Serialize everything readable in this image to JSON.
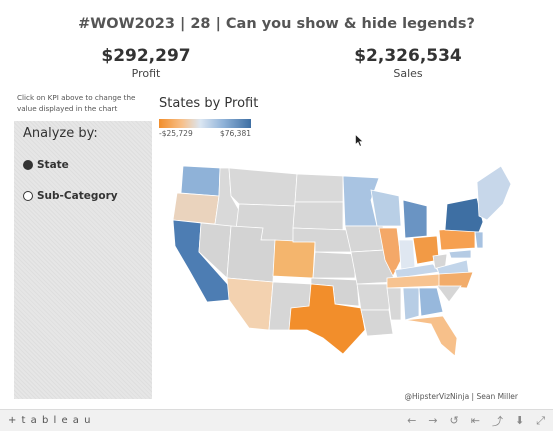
{
  "dashboard": {
    "title": "#WOW2023 | 28 | Can you show & hide legends?",
    "kpis": [
      {
        "value": "$292,297",
        "label": "Profit"
      },
      {
        "value": "$2,326,534",
        "label": "Sales"
      }
    ],
    "hint": "Click on KPI above to change the value displayed in the chart",
    "credit": "@HipsterVizNinja | Sean Miller"
  },
  "panel": {
    "heading": "Analyze by:",
    "options": [
      {
        "label": "State",
        "selected": true
      },
      {
        "label": "Sub-Category",
        "selected": false
      }
    ]
  },
  "map": {
    "title": "States by Profit",
    "legend_min": "-$25,729",
    "legend_max": "$76,381",
    "colors": {
      "negative": "#f28e2b",
      "neutral": "#d4d4d4",
      "positive": "#3e6fa3"
    }
  },
  "toolbar": {
    "logo": "+ t a b l e a u",
    "icons": [
      "undo-icon",
      "redo-icon",
      "revert-icon",
      "pause-icon",
      "share-icon",
      "download-icon",
      "fullscreen-icon"
    ]
  }
}
